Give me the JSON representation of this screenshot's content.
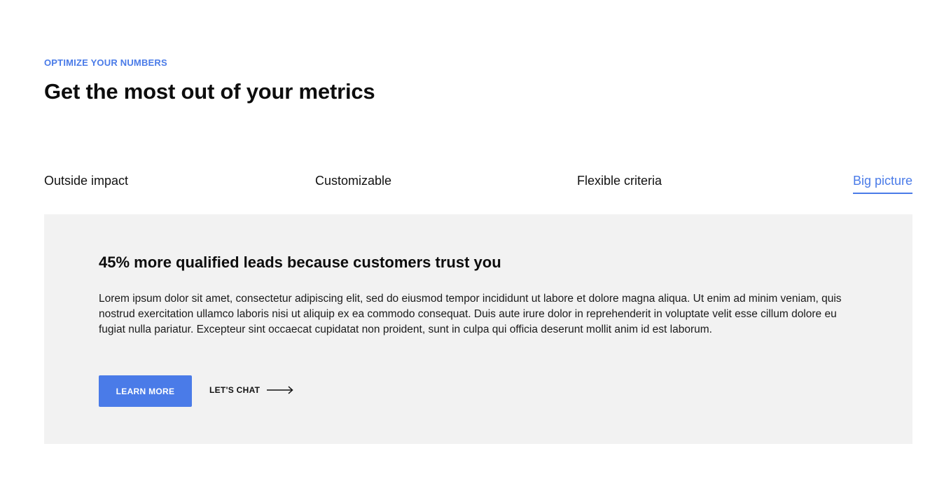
{
  "header": {
    "eyebrow": "OPTIMIZE YOUR NUMBERS",
    "title": "Get the most out of your metrics"
  },
  "tabs": [
    {
      "label": "Outside impact",
      "active": false
    },
    {
      "label": "Customizable",
      "active": false
    },
    {
      "label": "Flexible criteria",
      "active": false
    },
    {
      "label": "Big picture",
      "active": true
    }
  ],
  "panel": {
    "title": "45% more qualified leads because customers trust you",
    "body": "Lorem ipsum dolor sit amet, consectetur adipiscing elit, sed do eiusmod tempor incididunt ut labore et dolore magna aliqua. Ut enim ad minim veniam, quis nostrud exercitation ullamco laboris nisi ut aliquip ex ea commodo consequat. Duis aute irure dolor in reprehenderit in voluptate velit esse cillum dolore eu fugiat nulla pariatur. Excepteur sint occaecat cupidatat non proident, sunt in culpa qui officia deserunt mollit anim id est laborum.",
    "primary_button": "LEARN MORE",
    "secondary_link": "LET'S CHAT",
    "secondary_icon": "arrow-right-icon"
  },
  "colors": {
    "accent": "#4a7be8",
    "panel_background": "#f2f2f2",
    "text": "#111111"
  }
}
